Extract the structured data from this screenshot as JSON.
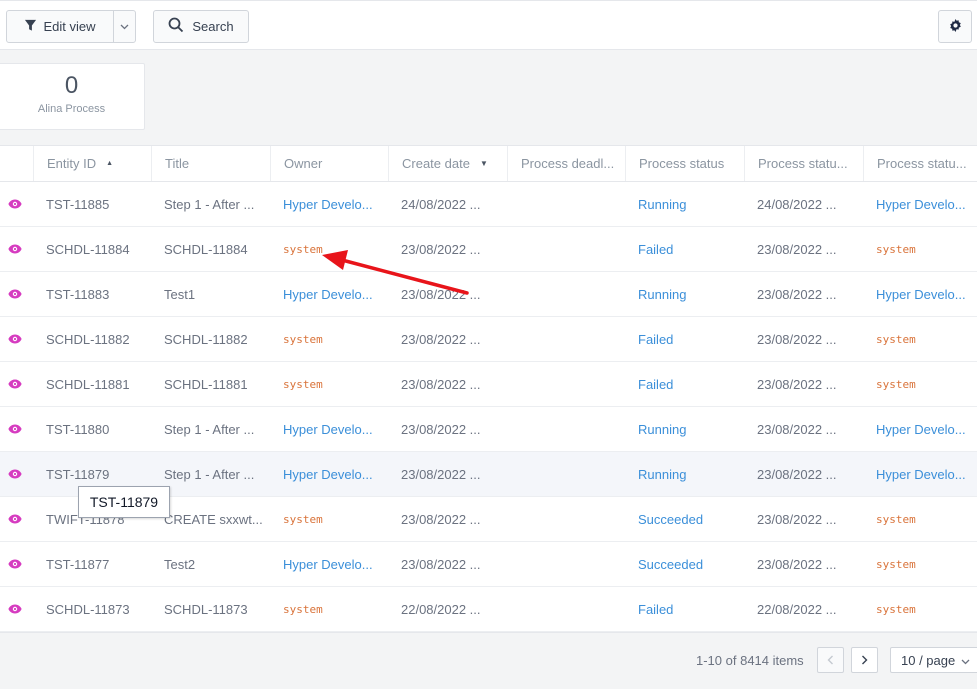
{
  "toolbar": {
    "edit_view_label": "Edit view",
    "search_label": "Search"
  },
  "stat": {
    "value": "0",
    "label": "Alina Process"
  },
  "table": {
    "columns": [
      "Entity ID",
      "Title",
      "Owner",
      "Create date",
      "Process deadl...",
      "Process status",
      "Process statu...",
      "Process statu..."
    ],
    "rows": [
      {
        "id": "TST-11885",
        "title": "Step 1 - After ...",
        "owner": "Hyper Develo...",
        "owner_type": "link",
        "date": "24/08/2022 ...",
        "deadline": "",
        "status": "Running",
        "status_date": "24/08/2022 ...",
        "status_by": "Hyper Develo...",
        "status_by_type": "link"
      },
      {
        "id": "SCHDL-11884",
        "title": "SCHDL-11884",
        "owner": "system",
        "owner_type": "mono",
        "date": "23/08/2022 ...",
        "deadline": "",
        "status": "Failed",
        "status_date": "23/08/2022 ...",
        "status_by": "system",
        "status_by_type": "mono"
      },
      {
        "id": "TST-11883",
        "title": "Test1",
        "owner": "Hyper Develo...",
        "owner_type": "link",
        "date": "23/08/2022 ...",
        "deadline": "",
        "status": "Running",
        "status_date": "23/08/2022 ...",
        "status_by": "Hyper Develo...",
        "status_by_type": "link"
      },
      {
        "id": "SCHDL-11882",
        "title": "SCHDL-11882",
        "owner": "system",
        "owner_type": "mono",
        "date": "23/08/2022 ...",
        "deadline": "",
        "status": "Failed",
        "status_date": "23/08/2022 ...",
        "status_by": "system",
        "status_by_type": "mono"
      },
      {
        "id": "SCHDL-11881",
        "title": "SCHDL-11881",
        "owner": "system",
        "owner_type": "mono",
        "date": "23/08/2022 ...",
        "deadline": "",
        "status": "Failed",
        "status_date": "23/08/2022 ...",
        "status_by": "system",
        "status_by_type": "mono"
      },
      {
        "id": "TST-11880",
        "title": "Step 1 - After ...",
        "owner": "Hyper Develo...",
        "owner_type": "link",
        "date": "23/08/2022 ...",
        "deadline": "",
        "status": "Running",
        "status_date": "23/08/2022 ...",
        "status_by": "Hyper Develo...",
        "status_by_type": "link"
      },
      {
        "id": "TST-11879",
        "title": "Step 1 - After ...",
        "owner": "Hyper Develo...",
        "owner_type": "link",
        "date": "23/08/2022 ...",
        "deadline": "",
        "status": "Running",
        "status_date": "23/08/2022 ...",
        "status_by": "Hyper Develo...",
        "status_by_type": "link"
      },
      {
        "id": "TWIFT-11878",
        "title": "CREATE sxxwt...",
        "owner": "system",
        "owner_type": "mono",
        "date": "23/08/2022 ...",
        "deadline": "",
        "status": "Succeeded",
        "status_date": "23/08/2022 ...",
        "status_by": "system",
        "status_by_type": "mono"
      },
      {
        "id": "TST-11877",
        "title": "Test2",
        "owner": "Hyper Develo...",
        "owner_type": "link",
        "date": "23/08/2022 ...",
        "deadline": "",
        "status": "Succeeded",
        "status_date": "23/08/2022 ...",
        "status_by": "system",
        "status_by_type": "mono"
      },
      {
        "id": "SCHDL-11873",
        "title": "SCHDL-11873",
        "owner": "system",
        "owner_type": "mono",
        "date": "22/08/2022 ...",
        "deadline": "",
        "status": "Failed",
        "status_date": "22/08/2022 ...",
        "status_by": "system",
        "status_by_type": "mono"
      }
    ]
  },
  "tooltip": {
    "text": "TST-11879"
  },
  "pagination": {
    "info": "1-10 of 8414 items",
    "page_size": "10 / page"
  },
  "colors": {
    "link": "#3b8fd9",
    "system": "#d9733a",
    "eye_icon": "#d63cc0",
    "annotation_arrow": "#e8141a"
  },
  "icons": {
    "edit_view": "filter-icon",
    "search": "search-icon",
    "settings": "gear-icon",
    "row": "eye-icon"
  }
}
